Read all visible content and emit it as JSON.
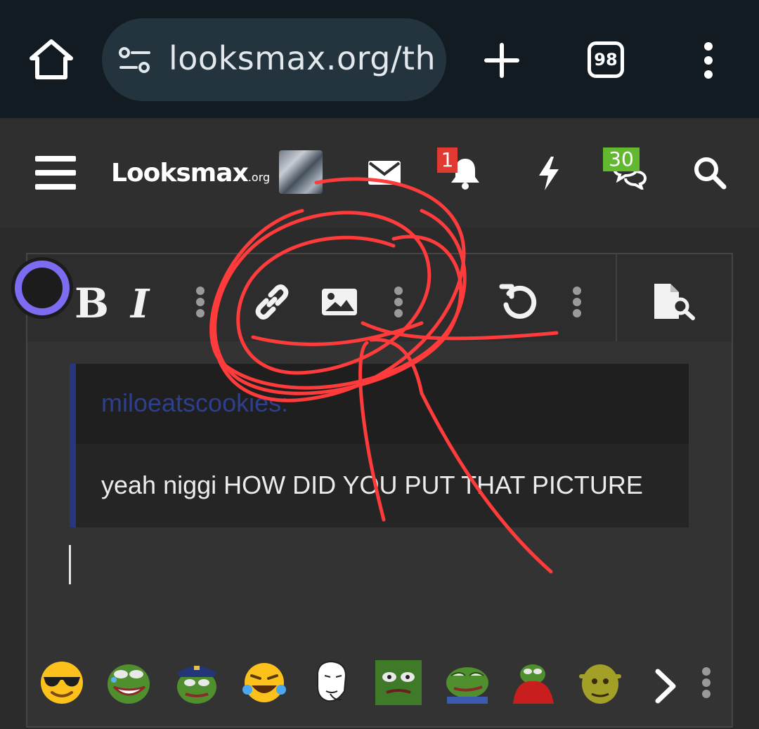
{
  "browser": {
    "url": "looksmax.org/th",
    "tab_count": "98",
    "icons": [
      "home-icon",
      "site-settings-icon",
      "new-tab-icon",
      "tab-switcher-icon",
      "browser-menu-icon"
    ]
  },
  "site": {
    "logo_main": "Looksmax",
    "logo_suffix": ".org",
    "alerts_count": "1",
    "conversations_count": "30",
    "icons": [
      "hamburger-menu-icon",
      "inbox-icon",
      "bell-icon",
      "bolt-icon",
      "conversations-icon",
      "search-icon"
    ]
  },
  "toolbar": {
    "bold_label": "B",
    "italic_label": "I",
    "icons": [
      "more-dots-icon",
      "link-icon",
      "image-icon",
      "undo-icon",
      "preview-icon"
    ]
  },
  "quote": {
    "author": "miloeatscookies:",
    "body": "yeah niggi HOW DID YOU PUT THAT PICTURE"
  },
  "smilies": [
    "cool-sunglasses-emoji",
    "pepe-laughing-tears",
    "pepe-police",
    "laughing-crying-emoji",
    "wojak-face",
    "pepe-green-face",
    "pepe-smug",
    "pepe-red-blanket",
    "shrek-face"
  ],
  "colors": {
    "browser_bg": "#121a22",
    "url_pill": "#23343f",
    "header_bg": "#2f2f2f",
    "editor_bg": "#333333",
    "quote_border": "#27377f",
    "alerts_badge": "#e03a33",
    "conversations_badge": "#62b82f",
    "annotation": "#ff3b3b"
  }
}
